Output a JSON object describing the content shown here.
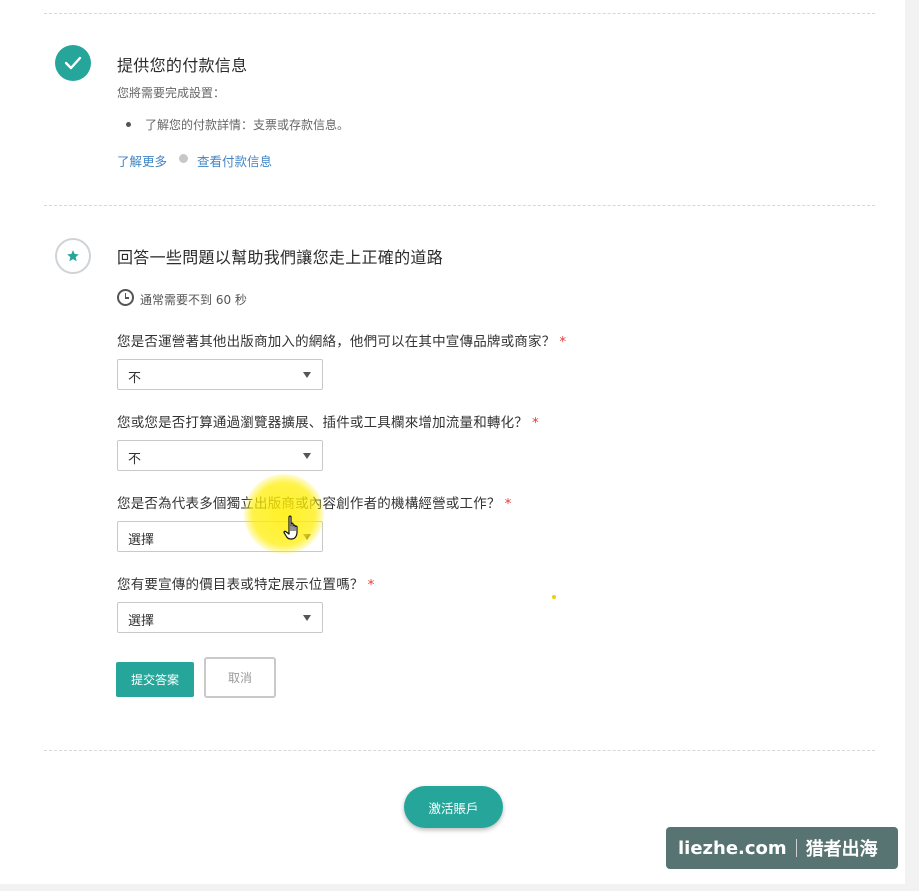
{
  "step_payment": {
    "title": "提供您的付款信息",
    "subtitle": "您將需要完成設置：",
    "bullet": "了解您的付款詳情：支票或存款信息。",
    "learn_more": "了解更多",
    "view_payment": "查看付款信息"
  },
  "step_questions": {
    "title": "回答一些問題以幫助我們讓您走上正確的道路",
    "time_hint": "通常需要不到 60 秒",
    "questions": [
      {
        "label": "您是否運營著其他出版商加入的網絡，他們可以在其中宣傳品牌或商家？",
        "required": "*",
        "selected": "不"
      },
      {
        "label": "您或您是否打算通過瀏覽器擴展、插件或工具欄來增加流量和轉化？",
        "required": "*",
        "selected": "不"
      },
      {
        "label": "您是否為代表多個獨立出版商或內容創作者的機構經營或工作？",
        "required": "*",
        "selected": "選擇"
      },
      {
        "label": "您有要宣傳的價目表或特定展示位置嗎？",
        "required": "*",
        "selected": "選擇"
      }
    ],
    "submit_label": "提交答案",
    "cancel_label": "取消"
  },
  "footer": {
    "activate_label": "激活賬戶"
  },
  "watermark": {
    "domain": "liezhe.com",
    "brand": "猎者出海"
  },
  "colors": {
    "accent": "#26a69a",
    "link": "#4285c4",
    "required": "#e53935"
  },
  "icons": {
    "step1": "check-circle-icon",
    "step2": "star-circle-icon",
    "time": "clock-icon",
    "dropdown": "caret-down-icon",
    "pointer": "hand-pointer-icon"
  }
}
